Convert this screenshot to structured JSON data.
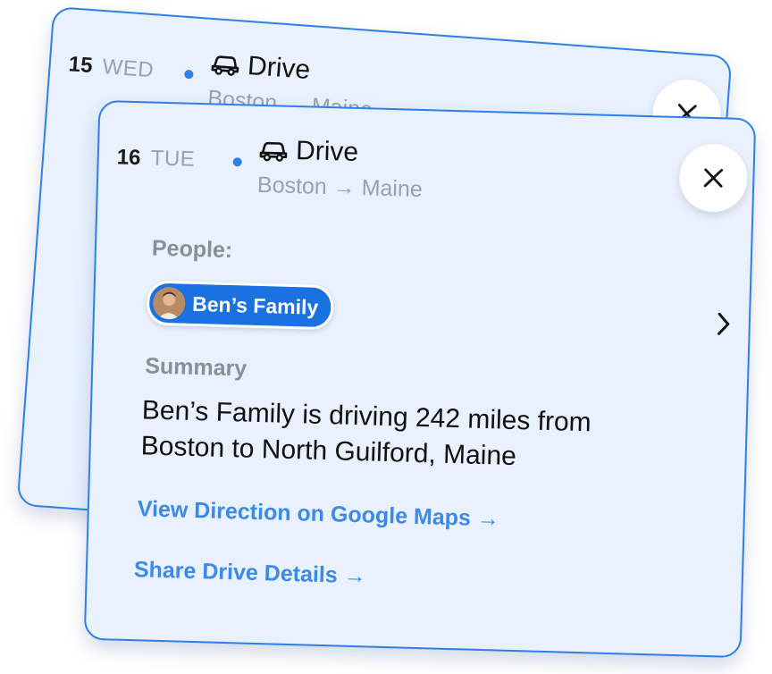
{
  "back_card": {
    "date_num": "15",
    "date_day": "WED",
    "title": "Drive",
    "route": "Boston → Maine",
    "icons": [
      "car-icon",
      "close-icon"
    ]
  },
  "front_card": {
    "date_num": "16",
    "date_day": "TUE",
    "title": "Drive",
    "route": "Boston → Maine",
    "people_label": "People:",
    "people_chip": "Ben’s Family",
    "summary_label": "Summary",
    "summary_text": "Ben’s Family is driving 242 miles from Boston to North Guilford, Maine",
    "link_maps": "View Direction on Google Maps →",
    "link_share": "Share Drive Details →",
    "icons": [
      "car-icon",
      "close-icon",
      "chevron-right-icon",
      "avatar"
    ]
  },
  "colors": {
    "card_bg": "#e8f1fd",
    "accent": "#2f7fe6",
    "chip_bg": "#1a72e0",
    "muted": "#9aa1a8",
    "link": "#3b8ae8"
  }
}
